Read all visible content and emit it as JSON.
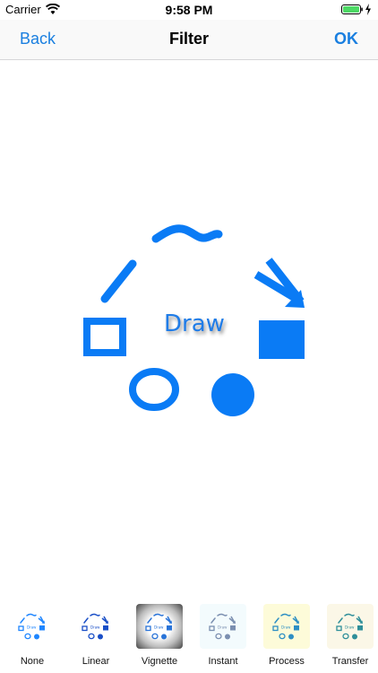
{
  "status_bar": {
    "carrier": "Carrier",
    "time": "9:58 PM"
  },
  "nav": {
    "back_label": "Back",
    "title": "Filter",
    "ok_label": "OK"
  },
  "canvas": {
    "draw_text": "Draw",
    "stroke_color": "#0a7bf5"
  },
  "filters": [
    {
      "label": "None"
    },
    {
      "label": "Linear"
    },
    {
      "label": "Vignette"
    },
    {
      "label": "Instant"
    },
    {
      "label": "Process"
    },
    {
      "label": "Transfer"
    }
  ]
}
